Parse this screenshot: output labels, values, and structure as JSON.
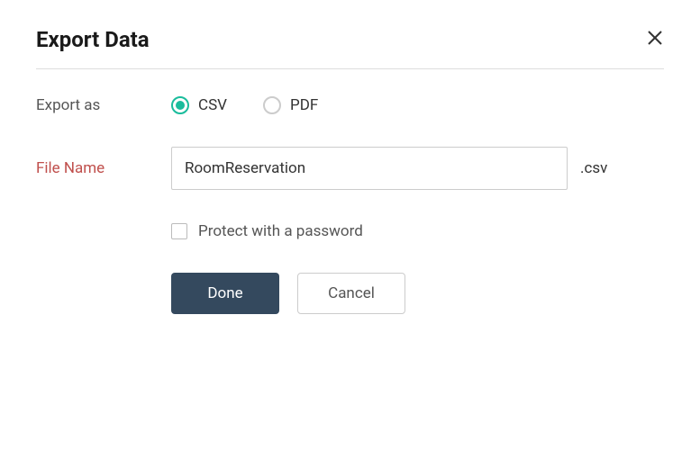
{
  "dialog": {
    "title": "Export Data"
  },
  "form": {
    "exportAs": {
      "label": "Export as",
      "options": {
        "csv": "CSV",
        "pdf": "PDF"
      },
      "selected": "csv"
    },
    "fileName": {
      "label": "File Name",
      "value": "RoomReservation",
      "extension": ".csv"
    },
    "protect": {
      "label": "Protect with a password",
      "checked": false
    }
  },
  "buttons": {
    "done": "Done",
    "cancel": "Cancel"
  }
}
